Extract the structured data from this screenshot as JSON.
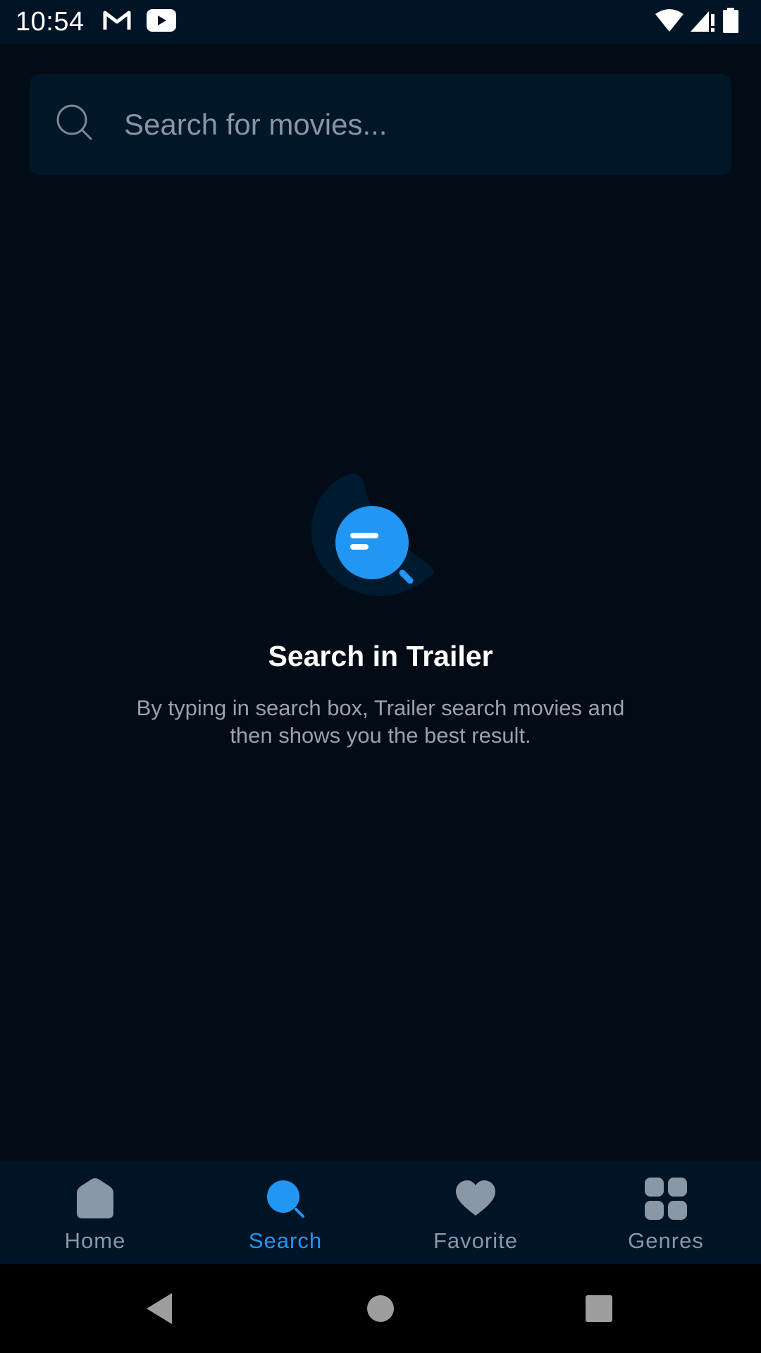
{
  "status_bar": {
    "time": "10:54",
    "icons_left": [
      "gmail-icon",
      "youtube-icon"
    ],
    "icons_right": [
      "wifi-icon",
      "signal-icon",
      "battery-icon"
    ]
  },
  "search": {
    "placeholder": "Search for movies...",
    "value": ""
  },
  "empty_state": {
    "title": "Search in Trailer",
    "description": "By typing in search box, Trailer search movies and then shows you the best result."
  },
  "bottom_nav": {
    "items": [
      {
        "label": "Home",
        "icon": "home-icon",
        "active": false
      },
      {
        "label": "Search",
        "icon": "search-icon",
        "active": true
      },
      {
        "label": "Favorite",
        "icon": "heart-icon",
        "active": false
      },
      {
        "label": "Genres",
        "icon": "grid-icon",
        "active": false
      }
    ]
  },
  "system_nav": [
    "back-icon",
    "home-circle-icon",
    "recents-icon"
  ],
  "colors": {
    "background": "#020c17",
    "surface": "#001427",
    "accent": "#2196f3",
    "inactive": "#8a97a4"
  }
}
